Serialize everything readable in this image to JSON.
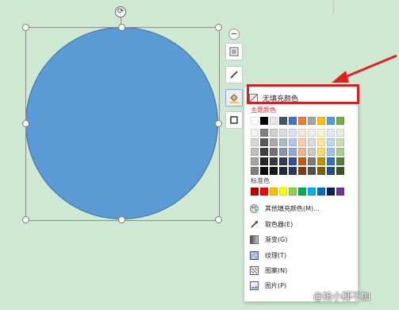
{
  "shape_toolbar": {
    "collapse_icon": "minus-icon",
    "buttons": [
      "layout-icon",
      "outline-pen-icon",
      "fill-bucket-icon",
      "shape-style-icon"
    ]
  },
  "fill_menu": {
    "no_fill_label": "无填充颜色",
    "theme_colors_label": "主题颜色",
    "standard_colors_label": "标准色",
    "theme_colors": [
      [
        "#ffffff",
        "#000000",
        "#e7e6e6",
        "#44546a",
        "#4472c4",
        "#ed7d31",
        "#a5a5a5",
        "#ffc000",
        "#5b9bd5",
        "#70ad47"
      ],
      [
        "#f2f2f2",
        "#7f7f7f",
        "#d0cece",
        "#d6dce4",
        "#d9e2f3",
        "#fbe5d5",
        "#ededed",
        "#fff2cc",
        "#deebf6",
        "#e2efd9"
      ],
      [
        "#d8d8d8",
        "#595959",
        "#aeaaaa",
        "#adb9ca",
        "#b4c6e7",
        "#f7cbac",
        "#dbdbdb",
        "#fee599",
        "#bdd7ee",
        "#c5e0b3"
      ],
      [
        "#bfbfbf",
        "#3f3f3f",
        "#757070",
        "#8496b0",
        "#8eaadb",
        "#f4b183",
        "#c9c9c9",
        "#ffd965",
        "#9dc3e6",
        "#a8d08d"
      ],
      [
        "#a5a5a5",
        "#262626",
        "#3a3838",
        "#323f4f",
        "#2f5496",
        "#c55a11",
        "#7b7b7b",
        "#bf9000",
        "#2e75b5",
        "#538135"
      ],
      [
        "#7f7f7f",
        "#0c0c0c",
        "#171616",
        "#222a35",
        "#1f3864",
        "#833c0b",
        "#525252",
        "#7f6000",
        "#1e4e79",
        "#375623"
      ]
    ],
    "standard_colors": [
      "#c00000",
      "#ff0000",
      "#ffc000",
      "#ffff00",
      "#92d050",
      "#00b050",
      "#00b0f0",
      "#0070c0",
      "#002060",
      "#7030a0"
    ],
    "items": [
      {
        "label": "其他填充颜色(M)...",
        "icon": "color-palette-icon"
      },
      {
        "label": "取色器(E)",
        "icon": "eyedropper-icon"
      },
      {
        "label": "渐变(G)",
        "icon": "gradient-icon"
      },
      {
        "label": "纹理(T)",
        "icon": "texture-icon"
      },
      {
        "label": "图案(N)",
        "icon": "pattern-icon"
      },
      {
        "label": "图片(P)",
        "icon": "picture-icon"
      }
    ]
  },
  "watermark": "@拾小椰不加",
  "colors": {
    "canvas": "#cfe8d2",
    "shape_fill": "#5b9bd5",
    "highlight": "#d42020"
  }
}
